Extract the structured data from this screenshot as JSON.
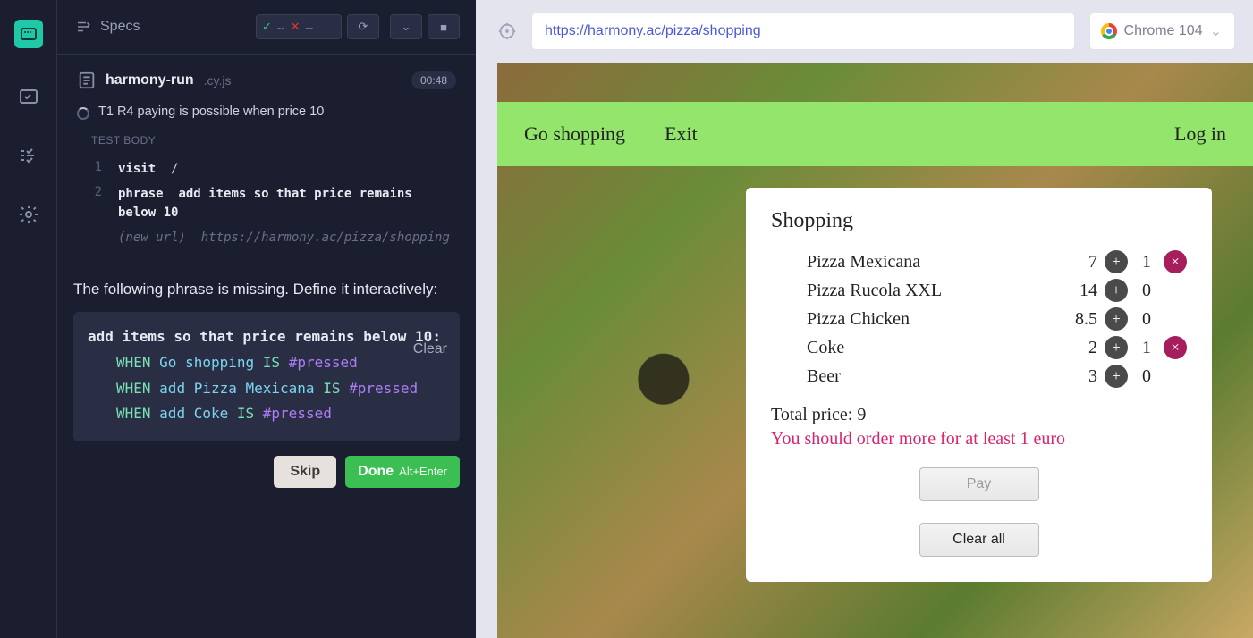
{
  "rail": {
    "tooltip": "App"
  },
  "header": {
    "specs_label": "Specs"
  },
  "spec": {
    "filename": "harmony-run",
    "file_ext": ".cy.js",
    "timer": "00:48",
    "test_title": "T1 R4 paying is possible when price 10",
    "body_label": "TEST BODY",
    "lines": [
      {
        "n": "1",
        "kw": "visit",
        "arg": "/"
      },
      {
        "n": "2",
        "kw": "phrase",
        "arg": "add items so that price remains below 10"
      }
    ],
    "comment_label": "(new url)",
    "comment_url": "https://harmony.ac/pizza/shopping"
  },
  "missing": {
    "prompt": "The following phrase is missing. Define it interactively:",
    "phrase": "add items so that price remains below 10:",
    "clear": "Clear",
    "steps": [
      {
        "obj": "Go shopping",
        "act": "#pressed"
      },
      {
        "obj": "add Pizza Mexicana",
        "act": "#pressed"
      },
      {
        "obj": "add Coke",
        "act": "#pressed"
      }
    ],
    "when": "WHEN",
    "is": "IS",
    "skip": "Skip",
    "done": "Done",
    "done_hint": "Alt+Enter"
  },
  "browser": {
    "url": "https://harmony.ac/pizza/shopping",
    "name": "Chrome 104"
  },
  "app": {
    "nav": {
      "shop": "Go shopping",
      "exit": "Exit",
      "login": "Log in"
    },
    "card_title": "Shopping",
    "items": [
      {
        "name": "Pizza Mexicana",
        "price": "7",
        "qty": "1",
        "removable": true
      },
      {
        "name": "Pizza Rucola XXL",
        "price": "14",
        "qty": "0",
        "removable": false
      },
      {
        "name": "Pizza Chicken",
        "price": "8.5",
        "qty": "0",
        "removable": false
      },
      {
        "name": "Coke",
        "price": "2",
        "qty": "1",
        "removable": true
      },
      {
        "name": "Beer",
        "price": "3",
        "qty": "0",
        "removable": false
      }
    ],
    "total_label": "Total price: ",
    "total_value": "9",
    "warning": "You should order more for at least 1 euro",
    "pay": "Pay",
    "clear_all": "Clear all"
  }
}
